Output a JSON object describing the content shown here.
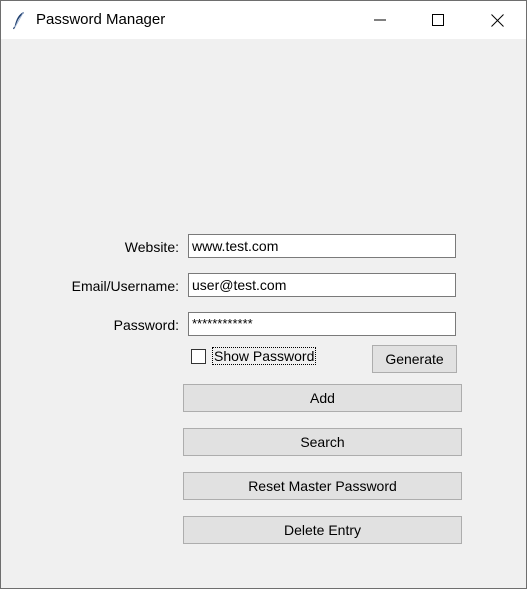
{
  "window": {
    "title": "Password Manager"
  },
  "form": {
    "website_label": "Website:",
    "website_value": "www.test.com",
    "email_label": "Email/Username:",
    "email_value": "user@test.com",
    "password_label": "Password:",
    "password_value": "************",
    "show_password_label": "Show Password",
    "show_password_checked": false
  },
  "buttons": {
    "generate": "Generate",
    "add": "Add",
    "search": "Search",
    "reset": "Reset Master Password",
    "delete": "Delete Entry"
  },
  "icons": {
    "app": "feather-icon",
    "minimize": "minimize-icon",
    "maximize": "maximize-icon",
    "close": "close-icon"
  }
}
